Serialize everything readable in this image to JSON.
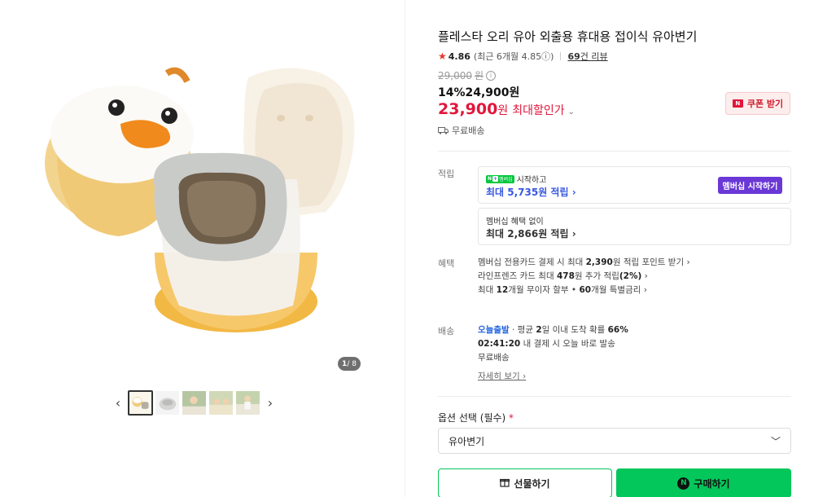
{
  "gallery": {
    "page_current": "1",
    "page_total": "/ 8",
    "thumb_count": 5,
    "prev_icon": "‹",
    "next_icon": "›"
  },
  "product": {
    "title": "플레스타 오리 유아 외출용 휴대용 접이식 유아변기",
    "rating": "4.86",
    "recent_rating": "(최근 6개월 4.85ⓘ)",
    "review_count": "69",
    "review_suffix": "건 리뷰",
    "original_price": "29,000",
    "original_won": "원",
    "discount_line": "14%24,900원",
    "final_price": "23,900",
    "final_won": "원",
    "max_discount_label": "최대할인가",
    "coupon_label": "쿠폰 받기",
    "shipping_label": "무료배송"
  },
  "points": {
    "label": "적립",
    "membership_badge": "멤버십",
    "membership_line": "시작하고",
    "membership_max": "최대 5,735원 적립 ›",
    "membership_button": "멤버십 시작하기",
    "no_membership_line": "멤버십 혜택 없이",
    "no_membership_max": "최대 2,866원 적립 ›"
  },
  "benefits": {
    "label": "혜택",
    "item1_pre": "멤버십 전용카드 결제 시 최대 ",
    "item1_bold": "2,390",
    "item1_post": "원 적립 포인트 받기 ›",
    "item2_pre": "라인프렌즈 카드 최대 ",
    "item2_bold": "478",
    "item2_mid": "원 추가 적립",
    "item2_bold2": "(2%)",
    "item2_post": " ›",
    "item3_pre": "최대 ",
    "item3_bold": "12",
    "item3_mid": "개월 무이자 할부 • ",
    "item3_bold2": "60",
    "item3_post": "개월 특별금리 ›"
  },
  "delivery": {
    "label": "배송",
    "today": "오늘출발",
    "avg_pre": " · 평균 ",
    "avg_bold": "2",
    "avg_post": "일 이내 도착 확률 ",
    "avg_pct": "66%",
    "time": "02:41:20",
    "time_text": " 내 결제 시 오늘 바로 발송",
    "free": "무료배송",
    "detail_link": "자세히 보기 ›"
  },
  "options": {
    "label": "옵션 선택 (필수)",
    "required_mark": " *",
    "selected": "유아변기"
  },
  "actions": {
    "gift": "선물하기",
    "buy": "구매하기"
  },
  "colors": {
    "accent_red": "#e2163b",
    "naver_green": "#03c75a",
    "membership_purple": "#6a38d6",
    "link_blue": "#3857e0"
  }
}
